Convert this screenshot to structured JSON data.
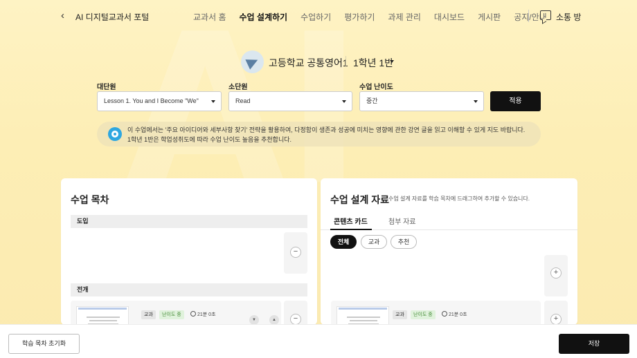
{
  "header": {
    "back_icon": "chevron-left-icon",
    "portal_title": "AI 디지털교과서 포털",
    "nav": [
      {
        "label": "교과서 홈",
        "active": false
      },
      {
        "label": "수업 설계하기",
        "active": true
      },
      {
        "label": "수업하기",
        "active": false
      },
      {
        "label": "평가하기",
        "active": false
      },
      {
        "label": "과제 관리",
        "active": false
      },
      {
        "label": "대시보드",
        "active": false
      },
      {
        "label": "게시판",
        "active": false
      },
      {
        "label": "공지/안내",
        "active": false
      }
    ],
    "chat_label": "소통 방",
    "chat_icon": "chat-icon"
  },
  "course": {
    "name": "고등학교 공통영어1",
    "class_name": "1학년 1반"
  },
  "filters": {
    "unit_label": "대단원",
    "unit_value": "Lesson 1. You and I Become \"We\"",
    "subunit_label": "소단원",
    "subunit_value": "Read",
    "difficulty_label": "수업 난이도",
    "difficulty_value": "중간",
    "apply_label": "적용"
  },
  "notice": {
    "line1": "이 수업에서는 '주요 아이디어와 세부사항 찾기' 전략을 활용하여, 다정함이 생존과 성공에 미치는 영향에 관한 강연 글을 읽고 이해할 수 있게 지도 바랍니다.",
    "line2": "1학년 1반은 학업성취도에 따라 수업 난이도 높음을 추천합니다."
  },
  "lesson_toc": {
    "title": "수업 목차",
    "sections": [
      {
        "label": "도입"
      },
      {
        "label": "전개"
      }
    ],
    "card": {
      "tag1": "교과",
      "tag2": "난이도 중",
      "duration": "21분 0초"
    },
    "remove_symbol": "−"
  },
  "design_materials": {
    "title": "수업 설계 자료",
    "subtitle": "수업 설계 자료를 학습 목차에 드래그하여 추가할 수 있습니다.",
    "tabs": [
      {
        "label": "콘텐츠 카드",
        "active": true
      },
      {
        "label": "첨부 자료",
        "active": false
      }
    ],
    "chips": [
      {
        "label": "전체",
        "active": true
      },
      {
        "label": "교과",
        "active": false
      },
      {
        "label": "추천",
        "active": false
      }
    ],
    "card": {
      "tag1": "교과",
      "tag2": "난이도 중",
      "duration": "21분 0초"
    },
    "add_symbol": "+"
  },
  "footer": {
    "reset_label": "학습 목차 초기화",
    "save_label": "저장"
  }
}
